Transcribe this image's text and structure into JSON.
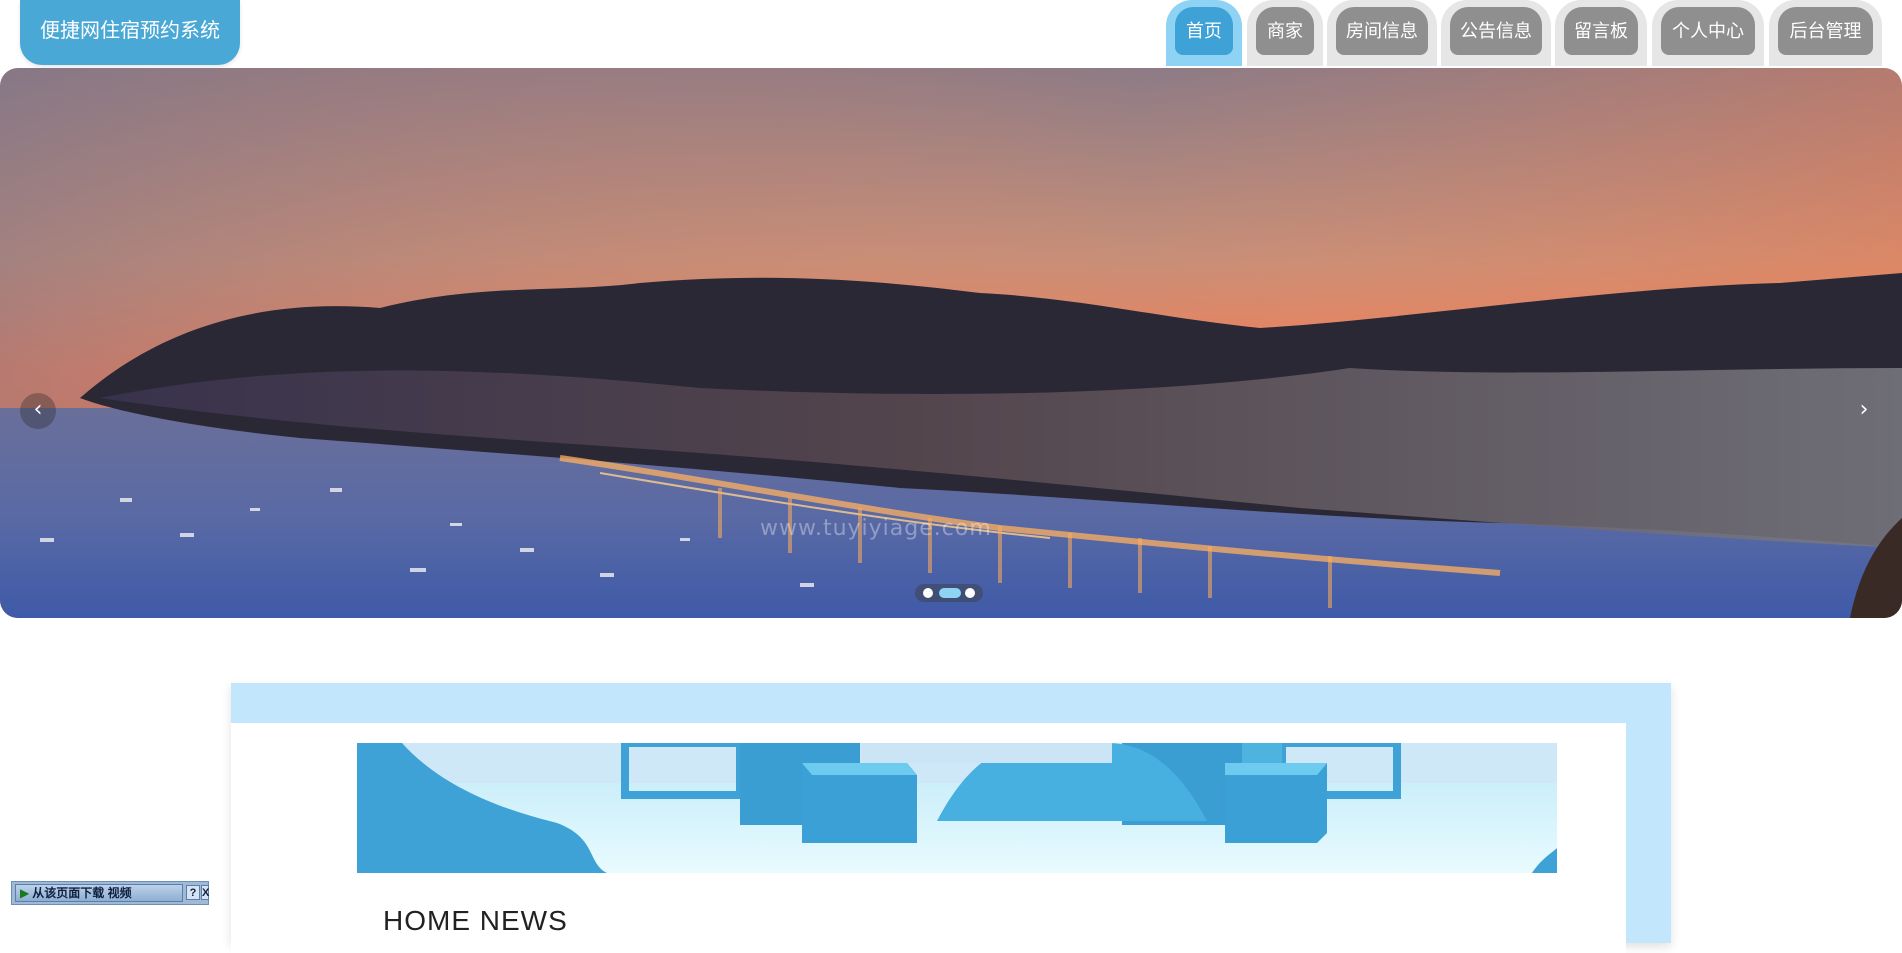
{
  "header": {
    "site_title": "便捷网住宿预约系统",
    "nav": [
      {
        "label": "首页",
        "active": true
      },
      {
        "label": "商家",
        "active": false
      },
      {
        "label": "房间信息",
        "active": false
      },
      {
        "label": "公告信息",
        "active": false
      },
      {
        "label": "留言板",
        "active": false
      },
      {
        "label": "个人中心",
        "active": false
      },
      {
        "label": "后台管理",
        "active": false
      }
    ]
  },
  "carousel": {
    "watermark": "www.tuyiyiage.com",
    "prev_icon": "‹",
    "next_icon": "›",
    "slide_count": 3,
    "active_slide": 2
  },
  "news": {
    "title": "HOME NEWS"
  },
  "download_widget": {
    "label": "从该页面下载 视频",
    "help": "?",
    "close": "X"
  },
  "colors": {
    "accent": "#3fa2d6",
    "accent_light": "#8ed3f4",
    "frame": "#c2e6fb",
    "tab_inactive": "#8f8f8f"
  }
}
